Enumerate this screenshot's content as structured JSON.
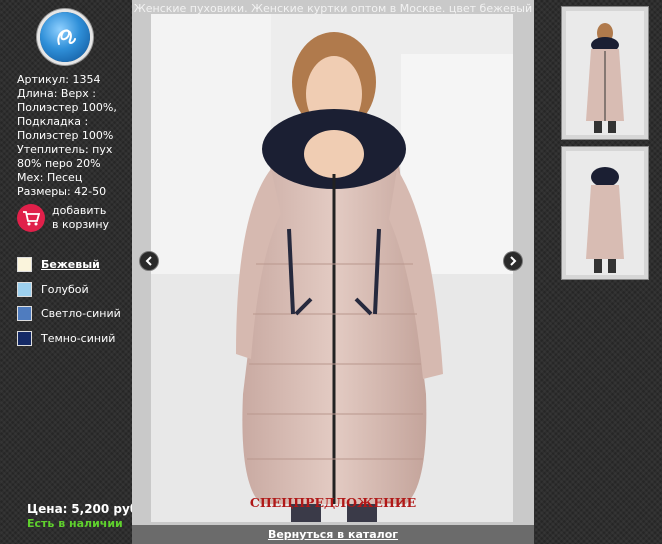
{
  "page_title": "Женские пуховики. Женские куртки оптом в Москве. цвет бежевый",
  "product": {
    "lines": [
      "Артикул: 1354",
      "Длина: Верх :",
      "Полиэстер 100%,",
      "Подкладка :",
      "Полиэстер 100%",
      "Утеплитель: пух",
      "80% перо 20%",
      "Мех: Песец",
      "Размеры: 42-50"
    ]
  },
  "cart": {
    "line1": "добавить",
    "line2": "в корзину"
  },
  "colors": [
    {
      "label": "Бежевый",
      "swatch": "#faf4dc",
      "selected": true
    },
    {
      "label": "Голубой",
      "swatch": "#9dd0ee",
      "selected": false
    },
    {
      "label": "Светло-синий",
      "swatch": "#4f7cbf",
      "selected": false
    },
    {
      "label": "Темно-синий",
      "swatch": "#152a66",
      "selected": false
    }
  ],
  "price": {
    "label": "Цена:",
    "value": "5,200 руб."
  },
  "stock": "Есть в наличии",
  "special_offer": "СПЕЦПРЕДЛОЖЕНИЕ",
  "back_link": "Вернуться в каталог",
  "icons": [
    "logo-icon",
    "cart-icon",
    "prev-arrow-icon",
    "next-arrow-icon"
  ],
  "accent_colors": {
    "stock": "#5fd12d",
    "special": "#b01818",
    "cart": "#e0204a"
  }
}
